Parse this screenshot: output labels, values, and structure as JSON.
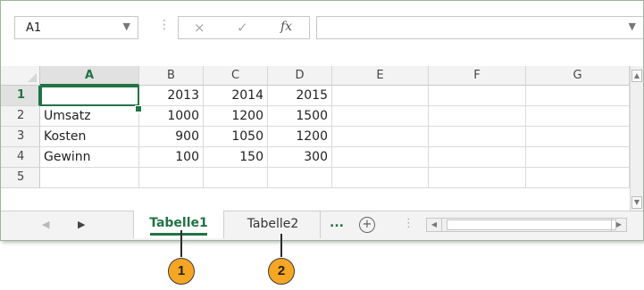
{
  "formula_bar": {
    "name_box": "A1",
    "name_dropdown_icon": "chevron-down-icon",
    "cancel_icon": "×",
    "enter_icon": "✓",
    "fx_label": "fx",
    "formula_value": ""
  },
  "grid": {
    "columns": [
      "A",
      "B",
      "C",
      "D",
      "E",
      "F",
      "G"
    ],
    "rows": [
      "1",
      "2",
      "3",
      "4",
      "5"
    ],
    "active_cell": "A1",
    "cells": {
      "r1": [
        "",
        "2013",
        "2014",
        "2015",
        "",
        "",
        ""
      ],
      "r2": [
        "Umsatz",
        "1000",
        "1200",
        "1500",
        "",
        "",
        ""
      ],
      "r3": [
        "Kosten",
        "900",
        "1050",
        "1200",
        "",
        "",
        ""
      ],
      "r4": [
        "Gewinn",
        "100",
        "150",
        "300",
        "",
        "",
        ""
      ],
      "r5": [
        "",
        "",
        "",
        "",
        "",
        "",
        ""
      ]
    }
  },
  "sheet_tabs": {
    "tabs": [
      {
        "label": "Tabelle1",
        "active": true
      },
      {
        "label": "Tabelle2",
        "active": false
      }
    ],
    "more": "...",
    "add": "+"
  },
  "callouts": [
    "1",
    "2"
  ],
  "colors": {
    "accent": "#217346",
    "callout": "#f5a623"
  }
}
